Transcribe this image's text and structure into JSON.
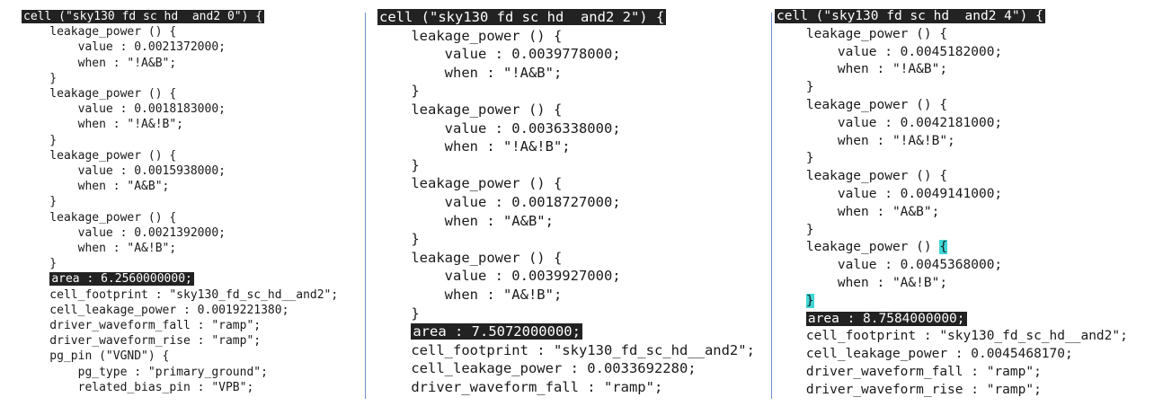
{
  "panels": [
    {
      "lines": [
        {
          "text": "cell (\"sky130 fd sc hd  and2 0\") {",
          "hl": true
        },
        {
          "text": "    leakage_power () {"
        },
        {
          "text": "        value : 0.0021372000;"
        },
        {
          "text": "        when : \"!A&B\";"
        },
        {
          "text": "    }"
        },
        {
          "text": "    leakage_power () {"
        },
        {
          "text": "        value : 0.0018183000;"
        },
        {
          "text": "        when : \"!A&!B\";"
        },
        {
          "text": "    }"
        },
        {
          "text": "    leakage_power () {"
        },
        {
          "text": "        value : 0.0015938000;"
        },
        {
          "text": "        when : \"A&B\";"
        },
        {
          "text": "    }"
        },
        {
          "text": "    leakage_power () {"
        },
        {
          "text": "        value : 0.0021392000;"
        },
        {
          "text": "        when : \"A&!B\";"
        },
        {
          "text": "    }"
        },
        {
          "text": "    area : 6.2560000000;",
          "hl": true
        },
        {
          "text": "    cell_footprint : \"sky130_fd_sc_hd__and2\";"
        },
        {
          "text": "    cell_leakage_power : 0.0019221380;"
        },
        {
          "text": "    driver_waveform_fall : \"ramp\";"
        },
        {
          "text": "    driver_waveform_rise : \"ramp\";"
        },
        {
          "text": "    pg_pin (\"VGND\") {"
        },
        {
          "text": "        pg_type : \"primary_ground\";"
        },
        {
          "text": "        related_bias_pin : \"VPB\";"
        }
      ]
    },
    {
      "lines": [
        {
          "text": "cell (\"sky130 fd sc hd  and2 2\") {",
          "hl": true
        },
        {
          "text": "    leakage_power () {"
        },
        {
          "text": "        value : 0.0039778000;"
        },
        {
          "text": "        when : \"!A&B\";"
        },
        {
          "text": "    }"
        },
        {
          "text": "    leakage_power () {"
        },
        {
          "text": "        value : 0.0036338000;"
        },
        {
          "text": "        when : \"!A&!B\";"
        },
        {
          "text": "    }"
        },
        {
          "text": "    leakage_power () {"
        },
        {
          "text": "        value : 0.0018727000;"
        },
        {
          "text": "        when : \"A&B\";"
        },
        {
          "text": "    }"
        },
        {
          "text": "    leakage_power () {"
        },
        {
          "text": "        value : 0.0039927000;"
        },
        {
          "text": "        when : \"A&!B\";"
        },
        {
          "text": "    }"
        },
        {
          "text": "    area : 7.5072000000;",
          "hl": true
        },
        {
          "text": "    cell_footprint : \"sky130_fd_sc_hd__and2\";"
        },
        {
          "text": "    cell_leakage_power : 0.0033692280;"
        },
        {
          "text": "    driver_waveform_fall : \"ramp\";"
        }
      ]
    },
    {
      "lines": [
        {
          "text": "cell (\"sky130 fd sc hd  and2 4\") {",
          "hl": true
        },
        {
          "text": "    leakage_power () {"
        },
        {
          "text": "        value : 0.0045182000;"
        },
        {
          "text": "        when : \"!A&B\";"
        },
        {
          "text": "    }"
        },
        {
          "text": "    leakage_power () {"
        },
        {
          "text": "        value : 0.0042181000;"
        },
        {
          "text": "        when : \"!A&!B\";"
        },
        {
          "text": "    }"
        },
        {
          "text": "    leakage_power () {"
        },
        {
          "text": "        value : 0.0049141000;"
        },
        {
          "text": "        when : \"A&B\";"
        },
        {
          "text": "    }"
        },
        {
          "text": "    leakage_power () {",
          "cyan_brace": true
        },
        {
          "text": "        value : 0.0045368000;"
        },
        {
          "text": "        when : \"A&!B\";"
        },
        {
          "text": "    }",
          "cyan_brace": true
        },
        {
          "text": "    area : 8.7584000000;",
          "hl": true
        },
        {
          "text": "    cell_footprint : \"sky130_fd_sc_hd__and2\";"
        },
        {
          "text": "    cell_leakage_power : 0.0045468170;"
        },
        {
          "text": "    driver_waveform_fall : \"ramp\";"
        },
        {
          "text": "    driver_waveform_rise : \"ramp\";"
        }
      ]
    }
  ],
  "colors": {
    "highlight": "#222222",
    "divider": "#6b8fc4",
    "brace_match": "#3fd6d6"
  }
}
